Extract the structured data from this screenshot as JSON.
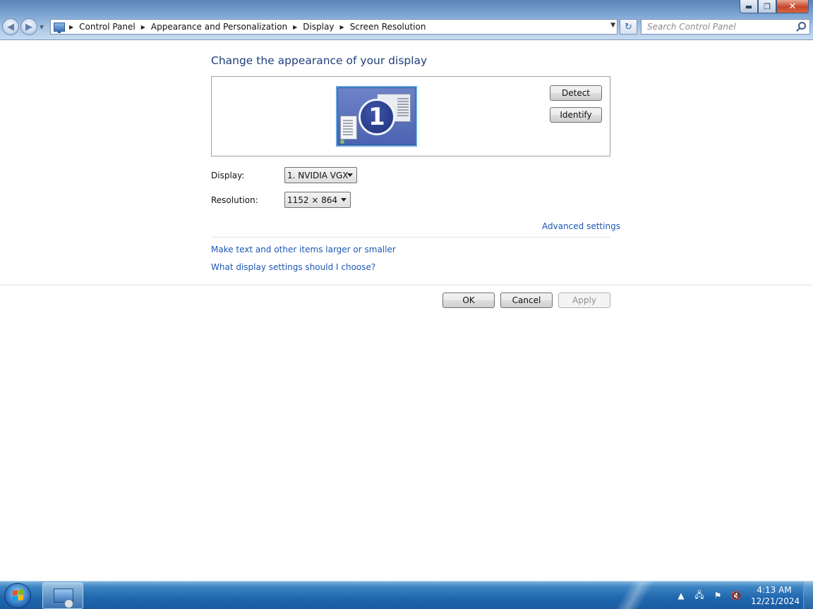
{
  "window": {
    "controls": {
      "minimize": "▬",
      "maximize": "❐",
      "close": "✕"
    }
  },
  "address_bar": {
    "breadcrumbs": [
      "Control Panel",
      "Appearance and Personalization",
      "Display",
      "Screen Resolution"
    ]
  },
  "search": {
    "placeholder": "Search Control Panel"
  },
  "main": {
    "title": "Change the appearance of your display",
    "monitor_number": "1",
    "detect_label": "Detect",
    "identify_label": "Identify",
    "display_label": "Display:",
    "display_value": "1. NVIDIA VGX",
    "resolution_label": "Resolution:",
    "resolution_value": "1152 × 864",
    "advanced_link": "Advanced settings",
    "link_text_size": "Make text and other items larger or smaller",
    "link_choose": "What display settings should I choose?"
  },
  "footer_buttons": {
    "ok": "OK",
    "cancel": "Cancel",
    "apply": "Apply"
  },
  "taskbar": {
    "time": "4:13 AM",
    "date": "12/21/2024"
  },
  "colors": {
    "link": "#1c57b5",
    "title": "#1e3f7a",
    "taskbar": "#1f66ad"
  }
}
